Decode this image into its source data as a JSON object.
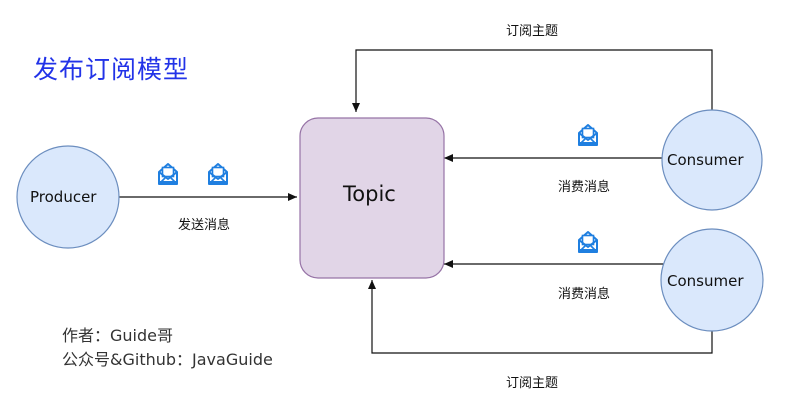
{
  "title": "发布订阅模型",
  "nodes": {
    "producer": "Producer",
    "topic": "Topic",
    "consumer1": "Consumer",
    "consumer2": "Consumer"
  },
  "edges": {
    "send": "发送消息",
    "consume1": "消费消息",
    "consume2": "消费消息",
    "subscribe_top": "订阅主题",
    "subscribe_bottom": "订阅主题"
  },
  "credits": {
    "author": "作者：Guide哥",
    "account": "公众号&Github：JavaGuide"
  },
  "icons": [
    "message-icon",
    "message-icon",
    "message-icon",
    "message-icon"
  ],
  "colors": {
    "title": "#2233e8",
    "node_fill": "#dae8fc",
    "node_stroke": "#6c8ebf",
    "topic_fill": "#e1d5e7",
    "topic_stroke": "#9673a6",
    "icon": "#1f7fe0"
  }
}
